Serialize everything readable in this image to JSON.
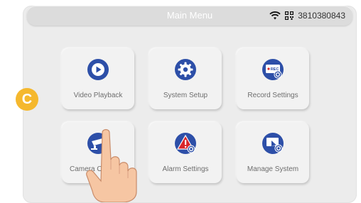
{
  "header": {
    "title": "Main Menu",
    "device_id": "3810380843",
    "wifi_icon": "wifi-icon",
    "qr_icon": "qr-code-icon"
  },
  "brand": {
    "letter": "C",
    "color": "#f5b82e"
  },
  "menu": {
    "items": [
      {
        "label": "Video Playback",
        "icon": "play-icon"
      },
      {
        "label": "System Setup",
        "icon": "gear-icon"
      },
      {
        "label": "Record Settings",
        "icon": "rec-settings-icon"
      },
      {
        "label": "Camera Overview",
        "icon": "camera-icon"
      },
      {
        "label": "Alarm Settings",
        "icon": "alarm-settings-icon"
      },
      {
        "label": "Manage System",
        "icon": "manage-system-icon"
      }
    ]
  },
  "colors": {
    "icon_blue": "#2d4fa8",
    "alarm_red": "#d9262b",
    "panel": "#ececec"
  }
}
